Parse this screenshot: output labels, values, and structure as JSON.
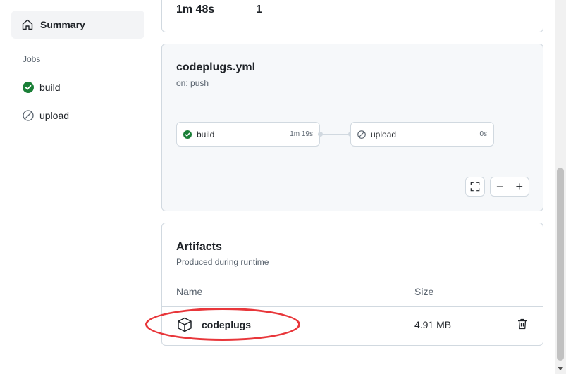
{
  "sidebar": {
    "summary_label": "Summary",
    "jobs_heading": "Jobs",
    "jobs": [
      {
        "label": "build",
        "status": "success"
      },
      {
        "label": "upload",
        "status": "skipped"
      }
    ]
  },
  "run_stats": {
    "duration": "1m 48s",
    "artifacts_count": "1"
  },
  "workflow": {
    "title": "codeplugs.yml",
    "trigger": "on: push",
    "jobs": [
      {
        "label": "build",
        "time": "1m 19s",
        "status": "success"
      },
      {
        "label": "upload",
        "time": "0s",
        "status": "skipped"
      }
    ],
    "controls": {
      "zoom_out": "−",
      "zoom_in": "+"
    }
  },
  "artifacts": {
    "title": "Artifacts",
    "subtitle": "Produced during runtime",
    "columns": {
      "name": "Name",
      "size": "Size"
    },
    "rows": [
      {
        "name": "codeplugs",
        "size": "4.91 MB"
      }
    ]
  },
  "colors": {
    "success": "#1a7f37",
    "skipped": "#59636e",
    "annotation": "#e8363a"
  }
}
